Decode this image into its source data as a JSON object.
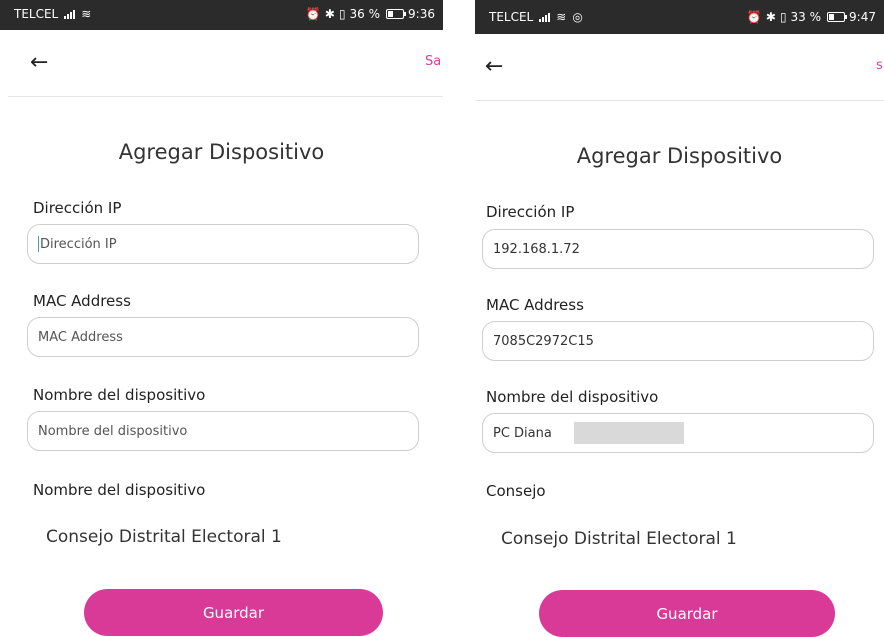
{
  "left": {
    "status": {
      "carrier": "TELCEL",
      "battery": "36 %",
      "time": "9:36"
    },
    "save_label": "Sa",
    "title": "Agregar Dispositivo",
    "ip": {
      "label": "Dirección IP",
      "placeholder": "Dirección IP"
    },
    "mac": {
      "label": "MAC Address",
      "placeholder": "MAC Address"
    },
    "name": {
      "label": "Nombre del dispositivo",
      "placeholder": "Nombre del dispositivo"
    },
    "council": {
      "label": "Nombre del dispositivo",
      "value": "Consejo Distrital Electoral 1"
    },
    "button": "Guardar"
  },
  "right": {
    "status": {
      "carrier": "TELCEL",
      "battery": "33 %",
      "time": "9:47"
    },
    "save_label": "s",
    "title": "Agregar Dispositivo",
    "ip": {
      "label": "Dirección IP",
      "value": "192.168.1.72"
    },
    "mac": {
      "label": "MAC Address",
      "value": "7085C2972C15"
    },
    "name": {
      "label": "Nombre del dispositivo",
      "value": "PC Diana"
    },
    "council": {
      "label": "Consejo",
      "value": "Consejo Distrital Electoral 1"
    },
    "button": "Guardar"
  }
}
